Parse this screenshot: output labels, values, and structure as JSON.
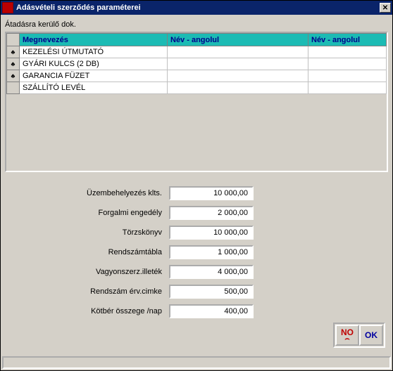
{
  "window": {
    "title": "Adásvételi szerződés paraméterei"
  },
  "section_label": "Átadásra kerülő dok.",
  "grid": {
    "headers": {
      "col1": "Megnevezés",
      "col2": "Név - angolul",
      "col3": "Név - angolul"
    },
    "marker_glyph": "♣",
    "rows": [
      {
        "marked": true,
        "name": "KEZELÉSI ÚTMUTATÓ",
        "en1": "",
        "en2": ""
      },
      {
        "marked": true,
        "name": "GYÁRI KULCS (2 DB)",
        "en1": "",
        "en2": ""
      },
      {
        "marked": true,
        "name": "GARANCIA FÜZET",
        "en1": "",
        "en2": ""
      },
      {
        "marked": false,
        "name": "SZÁLLÍTÓ LEVÉL",
        "en1": "",
        "en2": ""
      }
    ]
  },
  "form": {
    "rows": [
      {
        "label": "Üzembehelyezés klts.",
        "value": "10 000,00"
      },
      {
        "label": "Forgalmi engedély",
        "value": "2 000,00"
      },
      {
        "label": "Törzskönyv",
        "value": "10 000,00"
      },
      {
        "label": "Rendszámtábla",
        "value": "1 000,00"
      },
      {
        "label": "Vagyonszerz.illeték",
        "value": "4 000,00"
      },
      {
        "label": "Rendszám érv.cimke",
        "value": "500,00"
      },
      {
        "label": "Kötbér összege /nap",
        "value": "400,00"
      }
    ]
  },
  "buttons": {
    "no": "NO",
    "ok": "OK"
  }
}
